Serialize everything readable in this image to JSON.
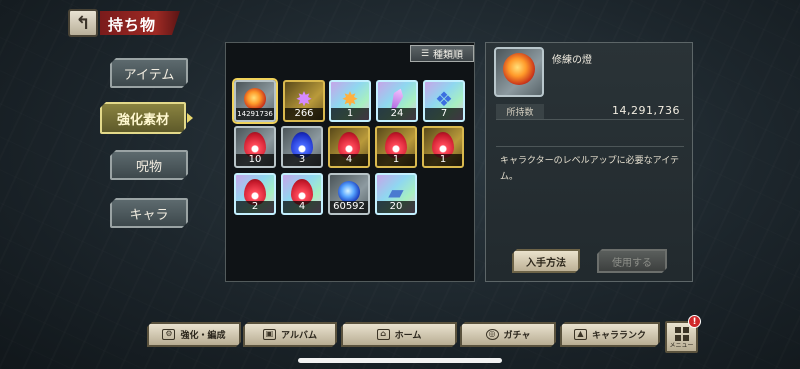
{
  "header": {
    "back_icon": "back-arrow-icon",
    "title": "持ち物"
  },
  "sidebar": {
    "items": [
      {
        "label": "アイテム",
        "active": false
      },
      {
        "label": "強化素材",
        "active": true
      },
      {
        "label": "呪物",
        "active": false
      },
      {
        "label": "キャラ",
        "active": false
      }
    ]
  },
  "grid": {
    "sort_label": "種類順",
    "items": [
      {
        "count": "14291736",
        "frame": "silver",
        "icon": "fire-orb",
        "selected": true
      },
      {
        "count": "266",
        "frame": "gold",
        "icon": "purple-spark"
      },
      {
        "count": "1",
        "frame": "rainbow",
        "icon": "purple-spark"
      },
      {
        "count": "24",
        "frame": "rainbow",
        "icon": "crystal-shard"
      },
      {
        "count": "7",
        "frame": "rainbow",
        "icon": "blue-shards"
      },
      {
        "count": "10",
        "frame": "silver",
        "icon": "red-flame"
      },
      {
        "count": "3",
        "frame": "silver",
        "icon": "blue-flame"
      },
      {
        "count": "4",
        "frame": "gold",
        "icon": "red-flame"
      },
      {
        "count": "1",
        "frame": "gold",
        "icon": "red-flame"
      },
      {
        "count": "1",
        "frame": "gold",
        "icon": "red-flame"
      },
      {
        "count": "2",
        "frame": "rainbow",
        "icon": "red-flame"
      },
      {
        "count": "4",
        "frame": "rainbow",
        "icon": "red-flame"
      },
      {
        "count": "60592",
        "frame": "silver",
        "icon": "blue-fire-orb"
      },
      {
        "count": "20",
        "frame": "rainbow",
        "icon": "blue-tablet"
      }
    ]
  },
  "detail": {
    "name": "修練の燈",
    "holding_label": "所持数",
    "holding_value": "14,291,736",
    "description": "キャラクターのレベルアップに必要なアイテム。",
    "obtain_label": "入手方法",
    "use_label": "使用する"
  },
  "bottom_nav": {
    "items": [
      {
        "label": "強化・編成",
        "icon": "upgrade-icon"
      },
      {
        "label": "アルバム",
        "icon": "album-icon"
      },
      {
        "label": "ホーム",
        "icon": "home-icon"
      },
      {
        "label": "ガチャ",
        "icon": "gacha-icon"
      },
      {
        "label": "キャラランク",
        "icon": "rank-icon"
      }
    ],
    "menu_label": "メニュー",
    "menu_badge": "!"
  },
  "colors": {
    "accent_gold": "#e7d66e",
    "title_red": "#9e2a24"
  }
}
